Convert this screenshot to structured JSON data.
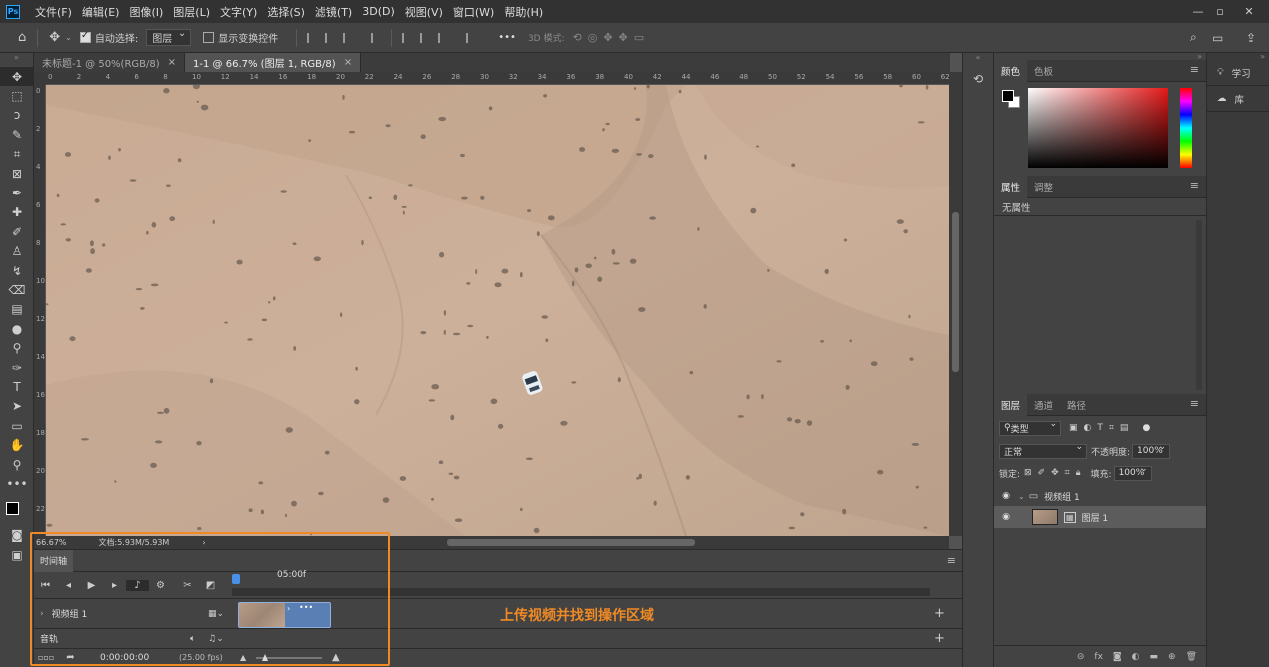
{
  "menubar": {
    "logo": "Ps",
    "items": [
      "文件(F)",
      "编辑(E)",
      "图像(I)",
      "图层(L)",
      "文字(Y)",
      "选择(S)",
      "滤镜(T)",
      "3D(D)",
      "视图(V)",
      "窗口(W)",
      "帮助(H)"
    ]
  },
  "options": {
    "auto_select_label": "自动选择:",
    "auto_select_value": "图层",
    "show_transform_label": "显示变换控件",
    "mode_3d_label": "3D 模式:",
    "more": "•••"
  },
  "tabs": [
    {
      "label": "未标题-1 @ 50%(RGB/8)",
      "close": "×"
    },
    {
      "label": "1-1 @ 66.7% (图层 1, RGB/8)",
      "close": "×"
    }
  ],
  "ruler": {
    "h": [
      "0",
      "2",
      "4",
      "6",
      "8",
      "10",
      "12",
      "14",
      "16",
      "18",
      "20",
      "22",
      "24",
      "26",
      "28",
      "30",
      "32",
      "34",
      "36",
      "38",
      "40",
      "42",
      "44",
      "46",
      "48",
      "50",
      "52",
      "54",
      "56",
      "58",
      "60",
      "62"
    ],
    "v": [
      "0",
      "2",
      "4",
      "6",
      "8",
      "10",
      "12",
      "14",
      "16",
      "18",
      "20",
      "22"
    ]
  },
  "status": {
    "zoom": "66.67%",
    "doc": "文档:5.93M/5.93M"
  },
  "timeline": {
    "title": "时间轴",
    "time_marker": "05:00f",
    "video_group": "视频组 1",
    "audio_track": "音轨",
    "timecode": "0:00:00:00",
    "fps": "(25.00 fps)",
    "clip_more": "•••"
  },
  "panels": {
    "color_tabs": [
      "颜色",
      "色板"
    ],
    "props_tabs": [
      "属性",
      "调整"
    ],
    "props_empty": "无属性",
    "layers_tabs": [
      "图层",
      "通道",
      "路径"
    ],
    "kind_filter": "类型",
    "blend_mode": "正常",
    "opacity_label": "不透明度:",
    "opacity_value": "100%",
    "lock_label": "锁定:",
    "fill_label": "填充:",
    "fill_value": "100%",
    "layers": [
      {
        "name": "视频组 1"
      },
      {
        "name": "图层 1"
      }
    ]
  },
  "farright": {
    "learn": "学习",
    "library": "库"
  },
  "annotation": {
    "caption": "上传视频并找到操作区域",
    "color": "#f08a24"
  }
}
